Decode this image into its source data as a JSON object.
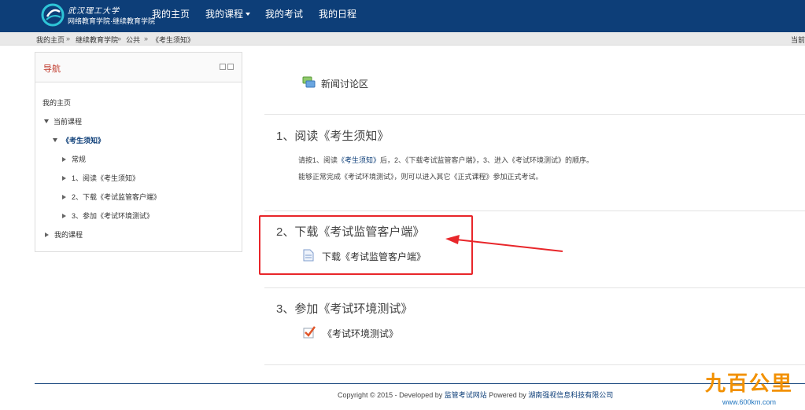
{
  "header": {
    "logo_line1": "武汉理工大学",
    "logo_line2": "网络教育学院·继续教育学院",
    "nav": [
      "我的主页",
      "我的课程",
      "我的考试",
      "我的日程"
    ]
  },
  "breadcrumb": {
    "items": [
      "我的主页",
      "继续教育学院",
      "公共",
      "《考生须知》"
    ],
    "separator": "»",
    "right_text": "当前"
  },
  "navblock": {
    "title": "导航",
    "home": "我的主页",
    "current_courses": "当前课程",
    "course": "《考生须知》",
    "sections": [
      "常规",
      "1、阅读《考生须知》",
      "2、下载《考试监管客户端》",
      "3、参加《考试环境测试》"
    ],
    "my_courses": "我的课程"
  },
  "main": {
    "forum": "新闻讨论区",
    "sections": [
      {
        "title": "1、阅读《考生须知》",
        "line1_a": "请按1、阅读",
        "line1_link": "《考生须知》",
        "line1_b": "后，2、《下载考试监管客户端》，3、进入《考试环境测试》的顺序。",
        "line2": "能够正常完成《考试环境测试》，则可以进入其它《正式课程》参加正式考试。"
      },
      {
        "title": "2、下载《考试监管客户端》",
        "activity": "下载《考试监管客户端》"
      },
      {
        "title": "3、参加《考试环境测试》",
        "activity": "《考试环境测试》"
      }
    ]
  },
  "footer": {
    "prefix": "Copyright © 2015 - Developed by ",
    "link1": "监管考试网站",
    "middle": " Powered by ",
    "link2": "湖南强视信息科技有限公司"
  },
  "watermark": {
    "text": "九百公里",
    "url": "www.600km.com"
  },
  "colors": {
    "header_bg": "#0d3e78",
    "annotation_red": "#e8262a",
    "watermark_orange": "#f29100"
  }
}
